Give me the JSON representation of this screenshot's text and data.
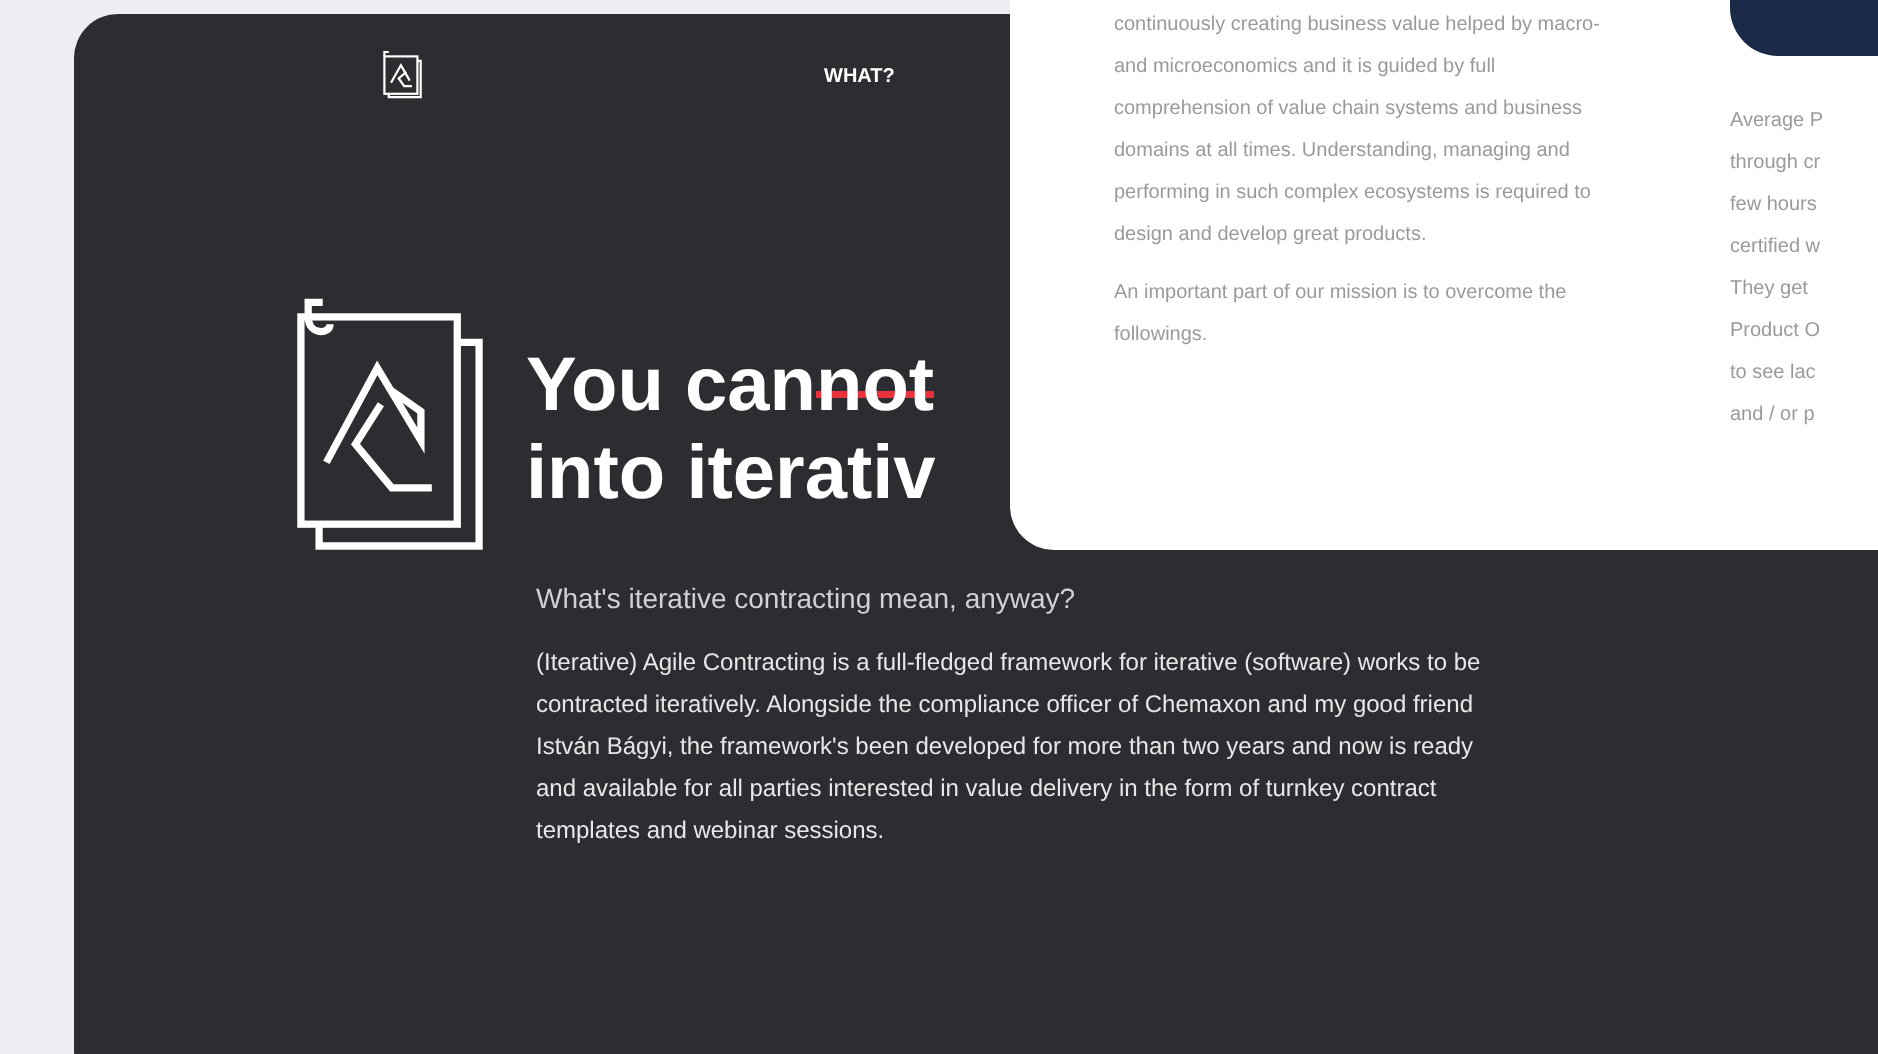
{
  "nav": {
    "items": [
      "WHAT?"
    ]
  },
  "hero": {
    "title_lines": [
      {
        "plain": "You can",
        "struck": "not"
      },
      {
        "plain": "into iterativ"
      }
    ],
    "subtitle": "What's iterative contracting mean, anyway?",
    "body": "(Iterative) Agile Contracting is a full-fledged framework for iterative (software) works to be contracted iteratively. Alongside the compliance officer of Chemaxon and my good friend István Bágyi, the framework's been developed for more than two years and now is ready and available for all parties interested in value delivery in the form of turnkey contract templates and webinar sessions."
  },
  "overlay_card": {
    "paragraphs": [
      "continuously creating business value helped by macro- and microeconomics and it is guided by full comprehension of value chain systems and business domains at all times. Understanding, managing and performing in such complex ecosystems is required to design and develop great products.",
      "An important part of our mission is to overcome the followings."
    ],
    "column_2_lines": [
      "Average P",
      "through cr",
      "few hours",
      "certified w",
      "They get",
      "Product O",
      "to see lac",
      "and / or p"
    ]
  }
}
